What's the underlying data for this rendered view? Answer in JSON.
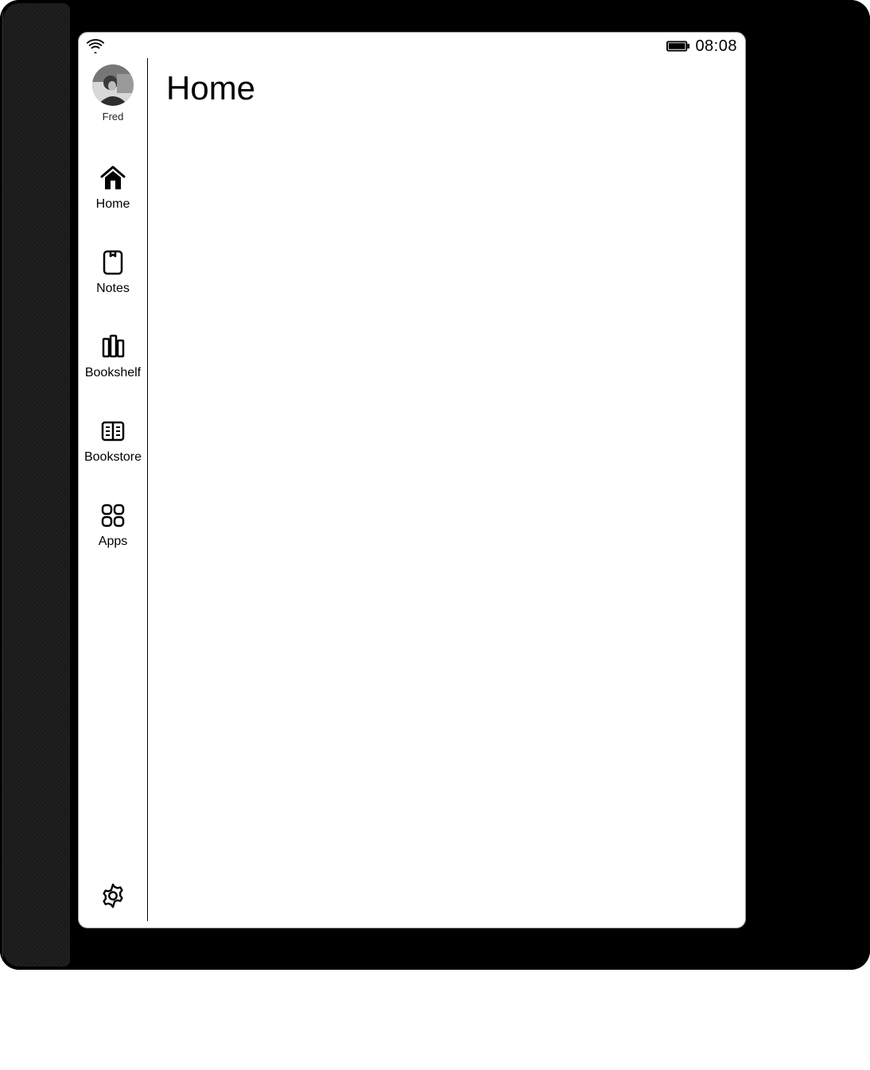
{
  "statusbar": {
    "time": "08:08"
  },
  "user": {
    "name": "Fred"
  },
  "sidebar": {
    "items": [
      {
        "label": "Home"
      },
      {
        "label": "Notes"
      },
      {
        "label": "Bookshelf"
      },
      {
        "label": "Bookstore"
      },
      {
        "label": "Apps"
      }
    ]
  },
  "main": {
    "title": "Home"
  }
}
